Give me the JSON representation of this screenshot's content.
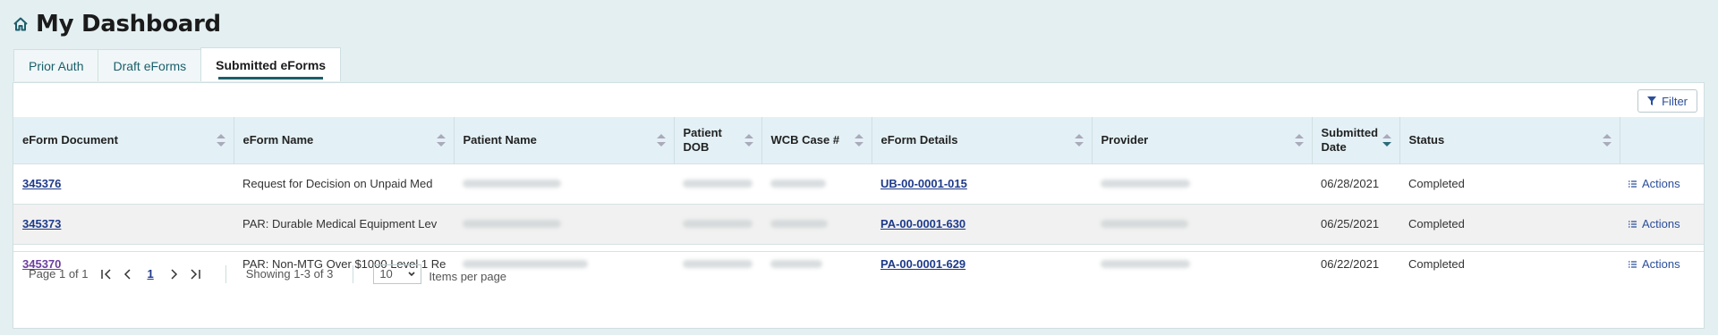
{
  "page": {
    "title": "My Dashboard"
  },
  "tabs": [
    {
      "label": "Prior Auth"
    },
    {
      "label": "Draft eForms"
    },
    {
      "label": "Submitted eForms"
    }
  ],
  "toolbar": {
    "filter_label": "Filter"
  },
  "table": {
    "columns": [
      {
        "label": "eForm Document"
      },
      {
        "label": "eForm Name"
      },
      {
        "label": "Patient Name"
      },
      {
        "label": "Patient DOB"
      },
      {
        "label": "WCB Case #"
      },
      {
        "label": "eForm Details"
      },
      {
        "label": "Provider"
      },
      {
        "label": "Submitted Date"
      },
      {
        "label": "Status"
      }
    ],
    "rows": [
      {
        "doc": "345376",
        "name": "Request for Decision on Unpaid Med",
        "details": "UB-00-0001-015",
        "date": "06/28/2021",
        "status": "Completed",
        "action": "Actions"
      },
      {
        "doc": "345373",
        "name": "PAR: Durable Medical Equipment Lev",
        "details": "PA-00-0001-630",
        "date": "06/25/2021",
        "status": "Completed",
        "action": "Actions"
      },
      {
        "doc": "345370",
        "name": "PAR: Non-MTG Over $1000 Level 1 Re",
        "details": "PA-00-0001-629",
        "date": "06/22/2021",
        "status": "Completed",
        "action": "Actions"
      }
    ]
  },
  "pager": {
    "page_of": "Page 1 of 1",
    "current": "1",
    "showing": "Showing 1-3 of 3",
    "per_page_value": "10",
    "per_page_label": "Items per page"
  }
}
